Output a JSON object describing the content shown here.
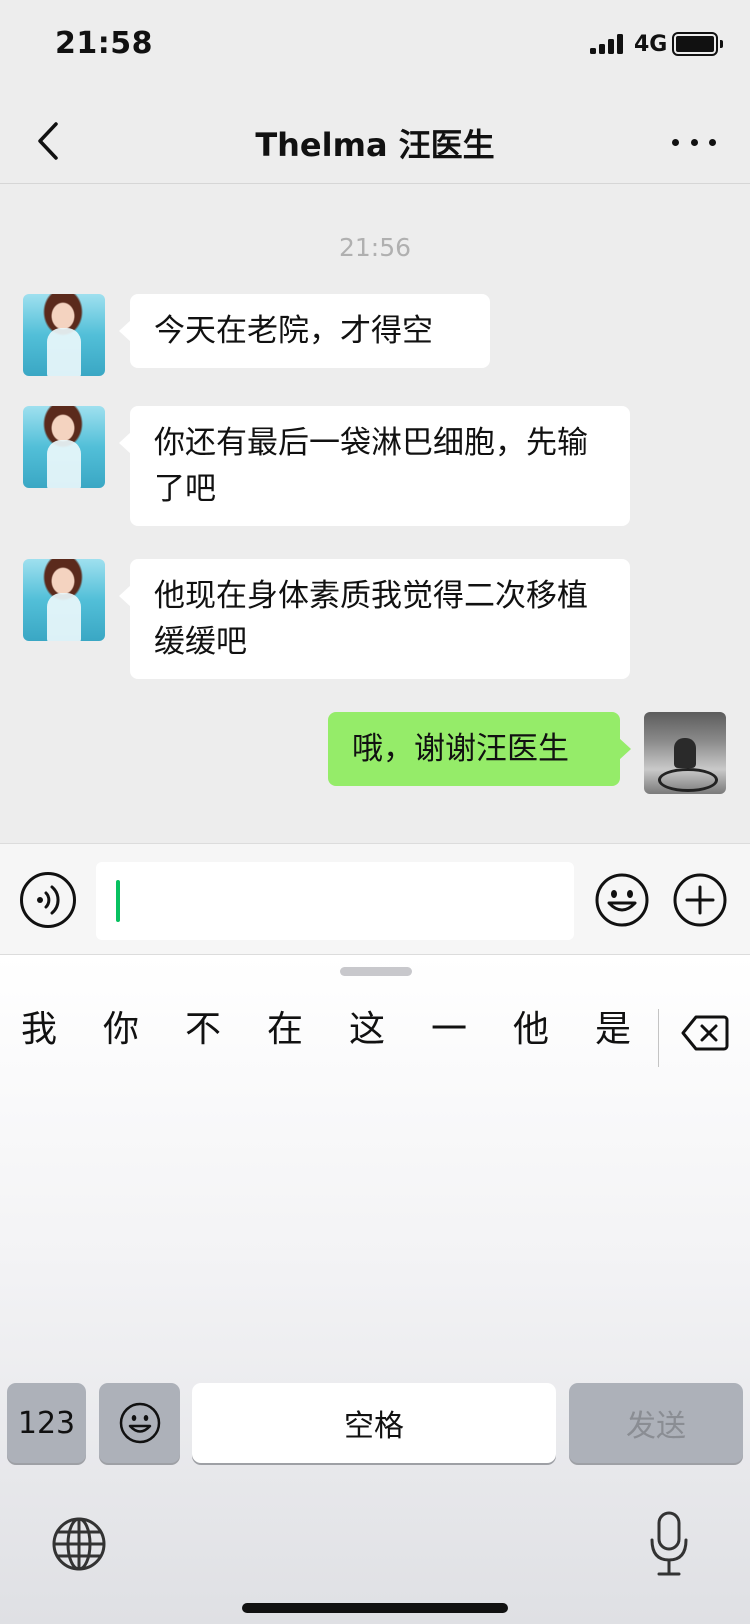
{
  "status_bar": {
    "time": "21:58",
    "network": "4G"
  },
  "nav": {
    "title": "Thelma 汪医生"
  },
  "chat": {
    "timestamp": "21:56",
    "messages": [
      {
        "sender": "contact",
        "text": "今天在老院，才得空"
      },
      {
        "sender": "contact",
        "text": "你还有最后一袋淋巴细胞，先输了吧"
      },
      {
        "sender": "contact",
        "text": "他现在身体素质我觉得二次移植缓缓吧"
      },
      {
        "sender": "self",
        "text": "哦，谢谢汪医生"
      }
    ]
  },
  "input": {
    "value": ""
  },
  "keyboard": {
    "candidates": [
      "我",
      "你",
      "不",
      "在",
      "这",
      "一",
      "他",
      "是"
    ],
    "key_123": "123",
    "key_space": "空格",
    "key_send": "发送"
  },
  "colors": {
    "background": "#ededed",
    "incoming_bubble": "#ffffff",
    "outgoing_bubble": "#95ec69",
    "caret": "#07c160"
  },
  "icons": {
    "back": "chevron-left-icon",
    "more": "more-dots-icon",
    "voice": "voice-icon",
    "emoji": "emoji-icon",
    "plus": "plus-circle-icon",
    "backspace": "backspace-icon",
    "globe": "globe-icon",
    "mic": "microphone-icon"
  }
}
